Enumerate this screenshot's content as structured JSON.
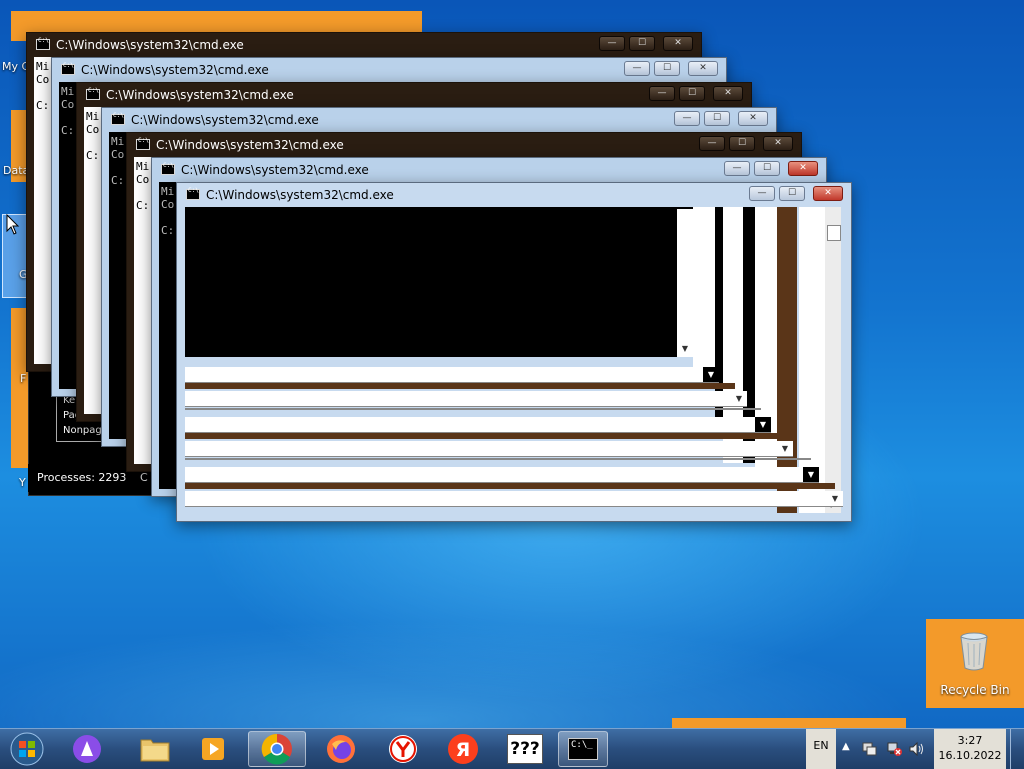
{
  "desktop": {
    "icon_labels": [
      "My C",
      "Data",
      "G",
      "F",
      "Y"
    ],
    "recycle_bin": {
      "label": "Recycle Bin",
      "icon": "recycle-bin-icon"
    }
  },
  "windows": [
    {
      "title": "C:\\Windows\\system32\\cmd.exe",
      "theme": "dark",
      "console_lines": [
        "Mi",
        "Co",
        "",
        "C:"
      ]
    },
    {
      "title": "C:\\Windows\\system32\\cmd.exe",
      "theme": "light",
      "console_lines": [
        "Mi",
        "Co",
        "",
        "C:"
      ]
    },
    {
      "title": "C:\\Windows\\system32\\cmd.exe",
      "theme": "dark",
      "console_lines": [
        "Mi",
        "Co",
        "",
        "C:"
      ]
    },
    {
      "title": "C:\\Windows\\system32\\cmd.exe",
      "theme": "light",
      "console_lines": [
        "Mi",
        "Co",
        "",
        "C:"
      ]
    },
    {
      "title": "C:\\Windows\\system32\\cmd.exe",
      "theme": "dark",
      "console_lines": [
        "Mi",
        "Co",
        "",
        "C:"
      ]
    },
    {
      "title": "C:\\Windows\\system32\\cmd.exe",
      "theme": "light",
      "console_lines": [
        "Mi",
        "Co",
        "",
        "C:"
      ]
    },
    {
      "title": "C:\\Windows\\system32\\cmd.exe",
      "theme": "light",
      "console_lines": []
    }
  ],
  "task_manager": {
    "processes": "Processes: 2293",
    "status_suffix": "C",
    "memory_lines": [
      "Ke",
      "Paged",
      "Nonpag"
    ]
  },
  "taskbar": {
    "start_icon": "windows-start-orb-icon",
    "pinned": [
      {
        "name": "alice-assistant-icon"
      },
      {
        "name": "file-explorer-icon"
      },
      {
        "name": "media-player-icon"
      },
      {
        "name": "chrome-icon",
        "active": true
      },
      {
        "name": "firefox-icon"
      },
      {
        "name": "yandex-browser-icon"
      },
      {
        "name": "yandex-icon"
      },
      {
        "name": "unknown-program-icon",
        "label": "???"
      },
      {
        "name": "cmd-icon",
        "active": true
      }
    ],
    "language": "EN",
    "time": "3:27",
    "date": "16.10.2022"
  },
  "colors": {
    "accent_orange": "#f39a2a",
    "console_bg": "#000000",
    "taskbar": "#2a4e7e"
  }
}
